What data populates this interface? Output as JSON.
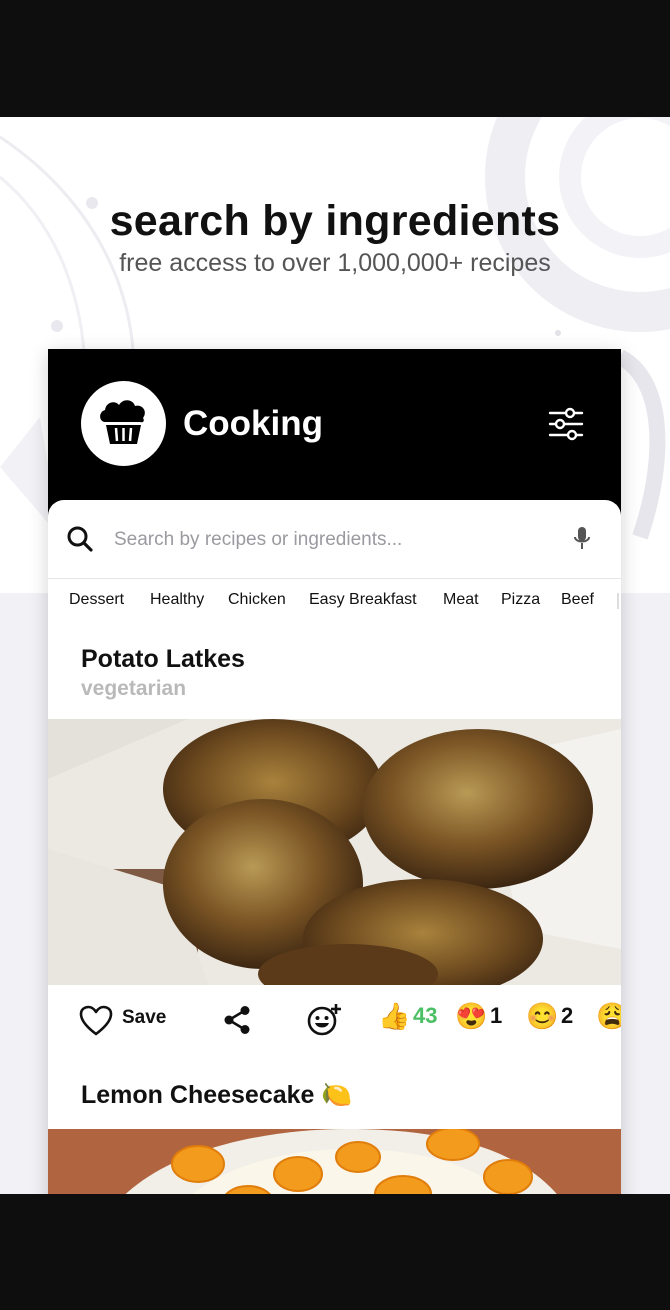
{
  "promo": {
    "headline": "search by ingredients",
    "subline": "free access to over 1,000,000+ recipes"
  },
  "app": {
    "title": "Cooking",
    "logo_icon": "muffin-icon",
    "filter_icon": "sliders-icon"
  },
  "search": {
    "placeholder": "Search by recipes or ingredients...",
    "value": "",
    "search_icon": "magnifier-icon",
    "mic_icon": "microphone-icon"
  },
  "categories": [
    "Dessert",
    "Healthy",
    "Chicken",
    "Easy Breakfast",
    "Meat",
    "Pizza",
    "Beef"
  ],
  "recipes": [
    {
      "title": "Potato Latkes",
      "subtitle": "vegetarian"
    },
    {
      "title": "Lemon Cheesecake 🍋"
    }
  ],
  "actions": {
    "save_label": "Save",
    "reactions": [
      {
        "emoji": "👍",
        "count": "43",
        "color": "#4cbf65"
      },
      {
        "emoji": "😍",
        "count": "1",
        "color": "#111111"
      },
      {
        "emoji": "😊",
        "count": "2",
        "color": "#111111"
      },
      {
        "emoji": "😩",
        "count": "",
        "color": "#111111"
      }
    ]
  },
  "colors": {
    "header_bg": "#000000",
    "accent_green": "#4cbf65",
    "muted_text": "#b9b9b9"
  }
}
